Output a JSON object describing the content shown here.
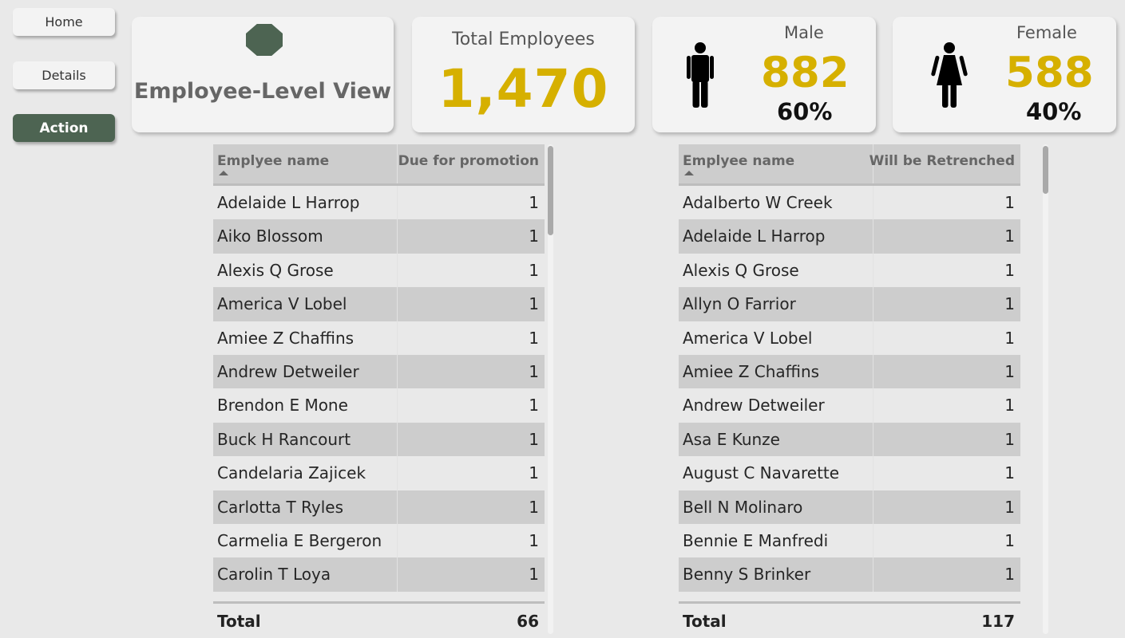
{
  "nav": {
    "home_label": "Home",
    "details_label": "Details",
    "action_label": "Action",
    "active_color": "#4d6452"
  },
  "title_card": {
    "title": "Employee-Level View",
    "logo_icon": "octagon-icon"
  },
  "total_card": {
    "label": "Total Employees",
    "value": "1,470"
  },
  "male_card": {
    "label": "Male",
    "count": "882",
    "percent": "60%",
    "icon": "male-person-icon"
  },
  "female_card": {
    "label": "Female",
    "count": "588",
    "percent": "40%",
    "icon": "female-person-icon"
  },
  "colors": {
    "accent": "#d6b000",
    "card_bg": "#f3f3f3",
    "row_alt": "#cdcdcd"
  },
  "promotion_table": {
    "columns": [
      "Emplyee name",
      "Due for promotion"
    ],
    "rows": [
      [
        "Adelaide L Harrop",
        "1"
      ],
      [
        "Aiko Blossom",
        "1"
      ],
      [
        "Alexis Q Grose",
        "1"
      ],
      [
        "America V Lobel",
        "1"
      ],
      [
        "Amiee Z Chaffins",
        "1"
      ],
      [
        "Andrew Detweiler",
        "1"
      ],
      [
        "Brendon E Mone",
        "1"
      ],
      [
        "Buck H Rancourt",
        "1"
      ],
      [
        "Candelaria Zajicek",
        "1"
      ],
      [
        "Carlotta T Ryles",
        "1"
      ],
      [
        "Carmelia E Bergeron",
        "1"
      ],
      [
        "Carolin T Loya",
        "1"
      ]
    ],
    "total_label": "Total",
    "total_value": "66"
  },
  "retrench_table": {
    "columns": [
      "Emplyee name",
      "Will be Retrenched"
    ],
    "rows": [
      [
        "Adalberto W Creek",
        "1"
      ],
      [
        "Adelaide L Harrop",
        "1"
      ],
      [
        "Alexis Q Grose",
        "1"
      ],
      [
        "Allyn O Farrior",
        "1"
      ],
      [
        "America V Lobel",
        "1"
      ],
      [
        "Amiee Z Chaffins",
        "1"
      ],
      [
        "Andrew Detweiler",
        "1"
      ],
      [
        "Asa E Kunze",
        "1"
      ],
      [
        "August C Navarette",
        "1"
      ],
      [
        "Bell N Molinaro",
        "1"
      ],
      [
        "Bennie E Manfredi",
        "1"
      ],
      [
        "Benny S Brinker",
        "1"
      ]
    ],
    "total_label": "Total",
    "total_value": "117"
  }
}
